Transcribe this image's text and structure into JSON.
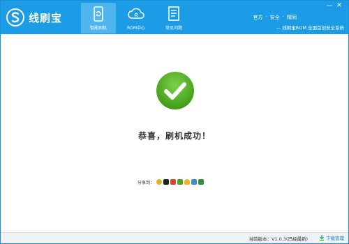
{
  "app": {
    "name": "线刷宝"
  },
  "nav": [
    {
      "label": "智能刷机",
      "icon": "phone-refresh-icon"
    },
    {
      "label": "ROM中心",
      "icon": "cloud-rom-icon"
    },
    {
      "label": "常见问题",
      "icon": "document-faq-icon"
    }
  ],
  "top_links": [
    "官方",
    "安全",
    "精同"
  ],
  "slogan": "线刷宝ROM 全国首创安全系统",
  "window_controls": {
    "minimize": "—",
    "close": "✕"
  },
  "main": {
    "message": "恭喜，刷机成功！",
    "share_label": "分享到：",
    "share_icons": [
      "weibo-icon",
      "qq-icon",
      "renren-icon",
      "kaixin-icon",
      "qzone-icon",
      "tencent-weibo-icon",
      "douban-icon"
    ]
  },
  "footer": {
    "version": "当前版本：V1.0.3(已经最新)",
    "download_label": "下载管理"
  },
  "colors": {
    "header": "#1c9be6",
    "success": "#4caf1e",
    "link": "#1c7fc9"
  }
}
